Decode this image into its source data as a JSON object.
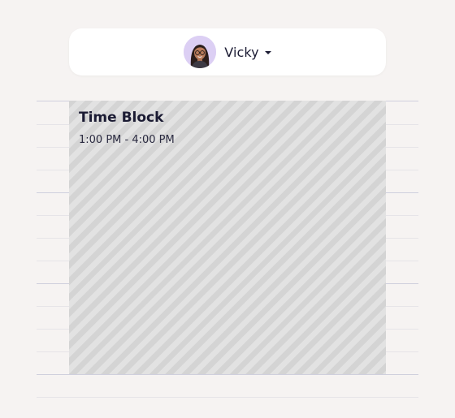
{
  "user": {
    "name": "Vicky",
    "avatar_icon": "person-avatar",
    "avatar_bg": "#dccff4"
  },
  "time_block": {
    "title": "Time Block",
    "time_range": "1:00 PM - 4:00 PM",
    "pattern_colors": [
      "#d4d4d4",
      "#e2e2e2"
    ]
  },
  "colors": {
    "background": "#f6f3f2",
    "text": "#1b1b33",
    "hour_line": "#cfcfdd",
    "half_line": "#e6e4e8"
  }
}
